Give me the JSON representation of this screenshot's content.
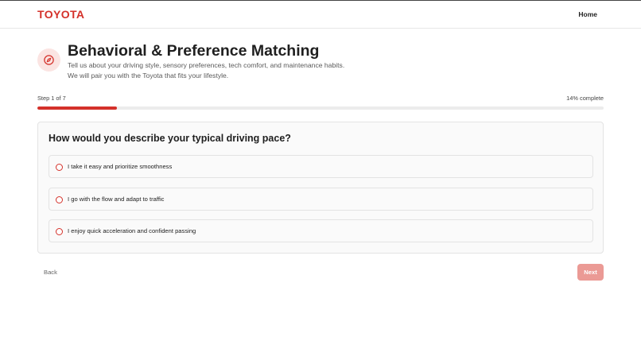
{
  "header": {
    "logo": "TOYOTA",
    "nav_home": "Home"
  },
  "hero": {
    "icon": "compass-icon",
    "title": "Behavioral & Preference Matching",
    "subtitle_line1": "Tell us about your driving style, sensory preferences, tech comfort, and maintenance habits.",
    "subtitle_line2": "We will pair you with the Toyota that fits your lifestyle."
  },
  "progress": {
    "step_text": "Step 1 of 7",
    "percent_text": "14% complete",
    "fraction": 0.14
  },
  "question": {
    "text": "How would you describe your typical driving pace?",
    "options": [
      {
        "label": "I take it easy and prioritize smoothness",
        "selected": false
      },
      {
        "label": "I go with the flow and adapt to traffic",
        "selected": false
      },
      {
        "label": "I enjoy quick acceleration and confident passing",
        "selected": false
      }
    ]
  },
  "footer": {
    "back_label": "Back",
    "next_label": "Next"
  },
  "colors": {
    "brand": "#d4312a",
    "next_disabled": "#eb9a95",
    "icon_bg": "#fbe4e2"
  }
}
